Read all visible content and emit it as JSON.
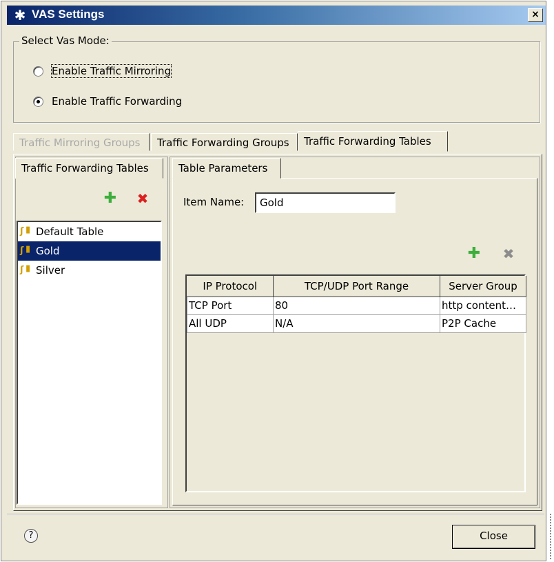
{
  "window": {
    "title": "VAS Settings",
    "close_glyph": "×"
  },
  "vas_mode": {
    "legend": "Select Vas Mode:",
    "options": [
      {
        "label": "Enable Traffic Mirroring",
        "checked": false
      },
      {
        "label": "Enable Traffic Forwarding",
        "checked": true
      }
    ]
  },
  "tabs": [
    {
      "label": "Traffic Mirroring Groups",
      "state": "disabled"
    },
    {
      "label": "Traffic Forwarding Groups",
      "state": "normal"
    },
    {
      "label": "Traffic Forwarding Tables",
      "state": "active"
    }
  ],
  "left": {
    "tab_label": "Traffic Forwarding Tables",
    "items": [
      {
        "label": "Default Table",
        "selected": false
      },
      {
        "label": "Gold",
        "selected": true
      },
      {
        "label": "Silver",
        "selected": false
      }
    ]
  },
  "right": {
    "tab_label": "Table Parameters",
    "item_name_label": "Item Name:",
    "item_name_value": "Gold",
    "table": {
      "columns": [
        "IP Protocol",
        "TCP/UDP Port Range",
        "Server Group"
      ],
      "rows": [
        [
          "TCP Port",
          "80",
          "http content…"
        ],
        [
          "All UDP",
          "N/A",
          "P2P Cache"
        ]
      ]
    }
  },
  "footer": {
    "help_glyph": "?",
    "close_label": "Close"
  },
  "icons": {
    "app": "asterisk-icon",
    "add": "plus-icon",
    "delete": "delete-icon",
    "table": "table-icon",
    "help": "help-icon"
  },
  "colors": {
    "selection": "#0a246a",
    "add_green": "#3cae3c",
    "delete_red": "#dc2020"
  }
}
